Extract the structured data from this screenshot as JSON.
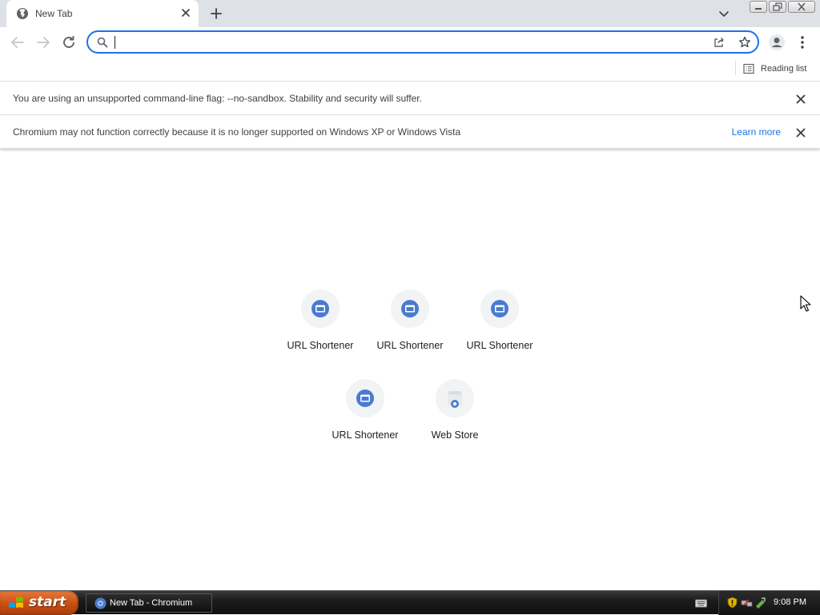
{
  "browser": {
    "tab": {
      "title": "New Tab"
    },
    "omnibox": {
      "value": "",
      "placeholder": ""
    },
    "bookmark_bar": {
      "reading_list_label": "Reading list"
    },
    "accent_color": "#1a73e8"
  },
  "infobars": [
    {
      "message": "You are using an unsupported command-line flag: --no-sandbox. Stability and security will suffer."
    },
    {
      "message": "Chromium may not function correctly because it is no longer supported on Windows XP or Windows Vista",
      "link": "Learn more"
    }
  ],
  "shortcuts": [
    {
      "label": "URL Shortener",
      "icon": "window-icon"
    },
    {
      "label": "URL Shortener",
      "icon": "window-icon"
    },
    {
      "label": "URL Shortener",
      "icon": "window-icon"
    },
    {
      "label": "URL Shortener",
      "icon": "window-icon"
    },
    {
      "label": "Web Store",
      "icon": "web-store-icon"
    }
  ],
  "taskbar": {
    "start_label": "start",
    "task_item_label": "New Tab - Chromium",
    "clock": "9:08 PM"
  }
}
